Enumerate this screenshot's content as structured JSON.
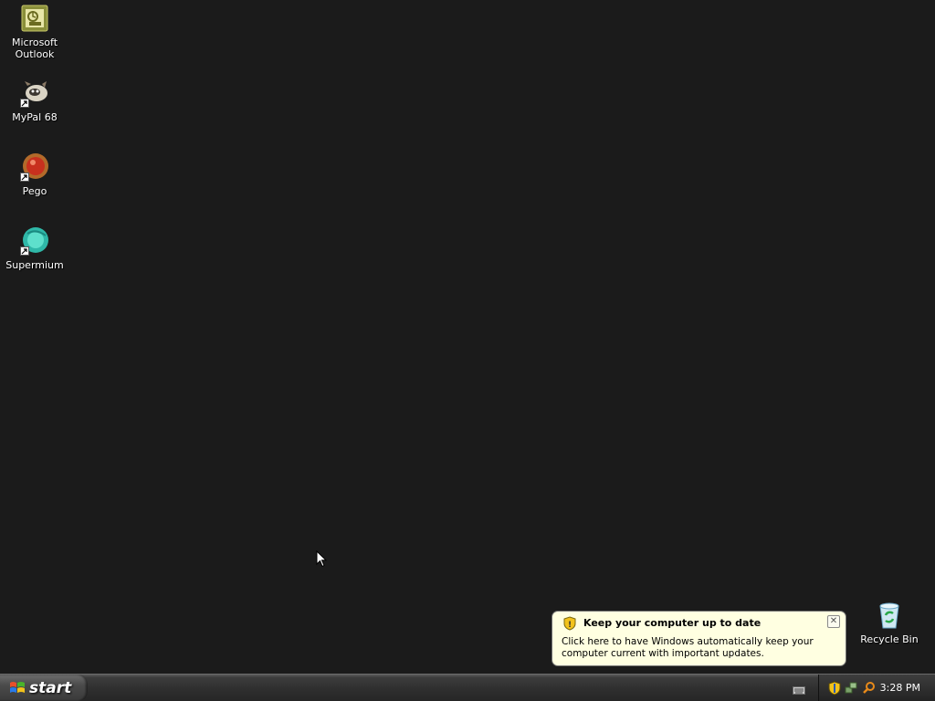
{
  "desktop": {
    "icons": [
      {
        "label": "Microsoft\nOutlook",
        "icon": "outlook-icon"
      },
      {
        "label": "MyPal 68",
        "icon": "mypal-icon"
      },
      {
        "label": "Pego",
        "icon": "pego-icon"
      },
      {
        "label": "Supermium",
        "icon": "supermium-icon"
      }
    ],
    "recycle_bin": {
      "label": "Recycle Bin",
      "icon": "recycle-bin-icon"
    }
  },
  "balloon": {
    "title": "Keep your computer up to date",
    "text": "Click here to have Windows automatically keep your computer current with important updates.",
    "close_label": "✕"
  },
  "taskbar": {
    "start_label": "start",
    "clock": "3:28 PM",
    "tray_icons": [
      "keyboard-icon",
      "security-shield-icon",
      "network-icon",
      "search-icon"
    ]
  },
  "colors": {
    "desktop_bg": "#1b1b1b",
    "balloon_bg": "#ffffe1"
  }
}
